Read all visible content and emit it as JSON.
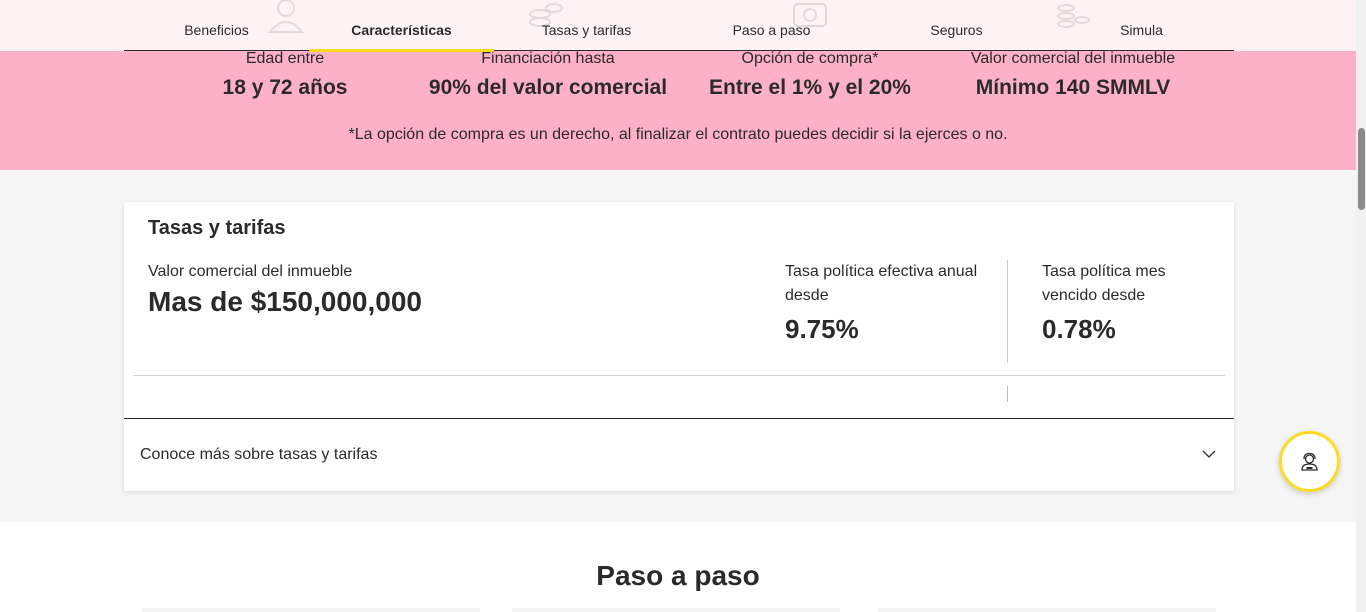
{
  "nav": {
    "tabs": [
      {
        "label": "Beneficios",
        "active": false
      },
      {
        "label": "Características",
        "active": true
      },
      {
        "label": "Tasas y tarifas",
        "active": false
      },
      {
        "label": "Paso a paso",
        "active": false
      },
      {
        "label": "Seguros",
        "active": false
      },
      {
        "label": "Simula",
        "active": false
      }
    ]
  },
  "features": {
    "items": [
      {
        "label": "Edad entre",
        "value": "18 y 72 años"
      },
      {
        "label": "Financiación hasta",
        "value": "90% del valor comercial"
      },
      {
        "label": "Opción de compra*",
        "value": "Entre el 1% y el 20%"
      },
      {
        "label": "Valor comercial del inmueble",
        "value": "Mínimo 140 SMMLV"
      }
    ],
    "note": "*La opción de compra es un derecho, al finalizar el contrato puedes decidir si la ejerces o no."
  },
  "rates": {
    "title": "Tasas y tarifas",
    "property_label": "Valor comercial del inmueble",
    "property_value": "Mas de $150,000,000",
    "annual_label": "Tasa política efectiva anual desde",
    "annual_value": "9.75%",
    "monthly_label": "Tasa política mes vencido desde",
    "monthly_value": "0.78%",
    "accordion_label": "Conoce más sobre tasas y tarifas"
  },
  "steps": {
    "title": "Paso a paso"
  },
  "colors": {
    "accent_yellow": "#fdda24",
    "band_pink": "#fdb1c9",
    "text_dark": "#2c2a29"
  },
  "icons": {
    "help": "agent-headset-icon",
    "accordion": "chevron-down-icon"
  }
}
